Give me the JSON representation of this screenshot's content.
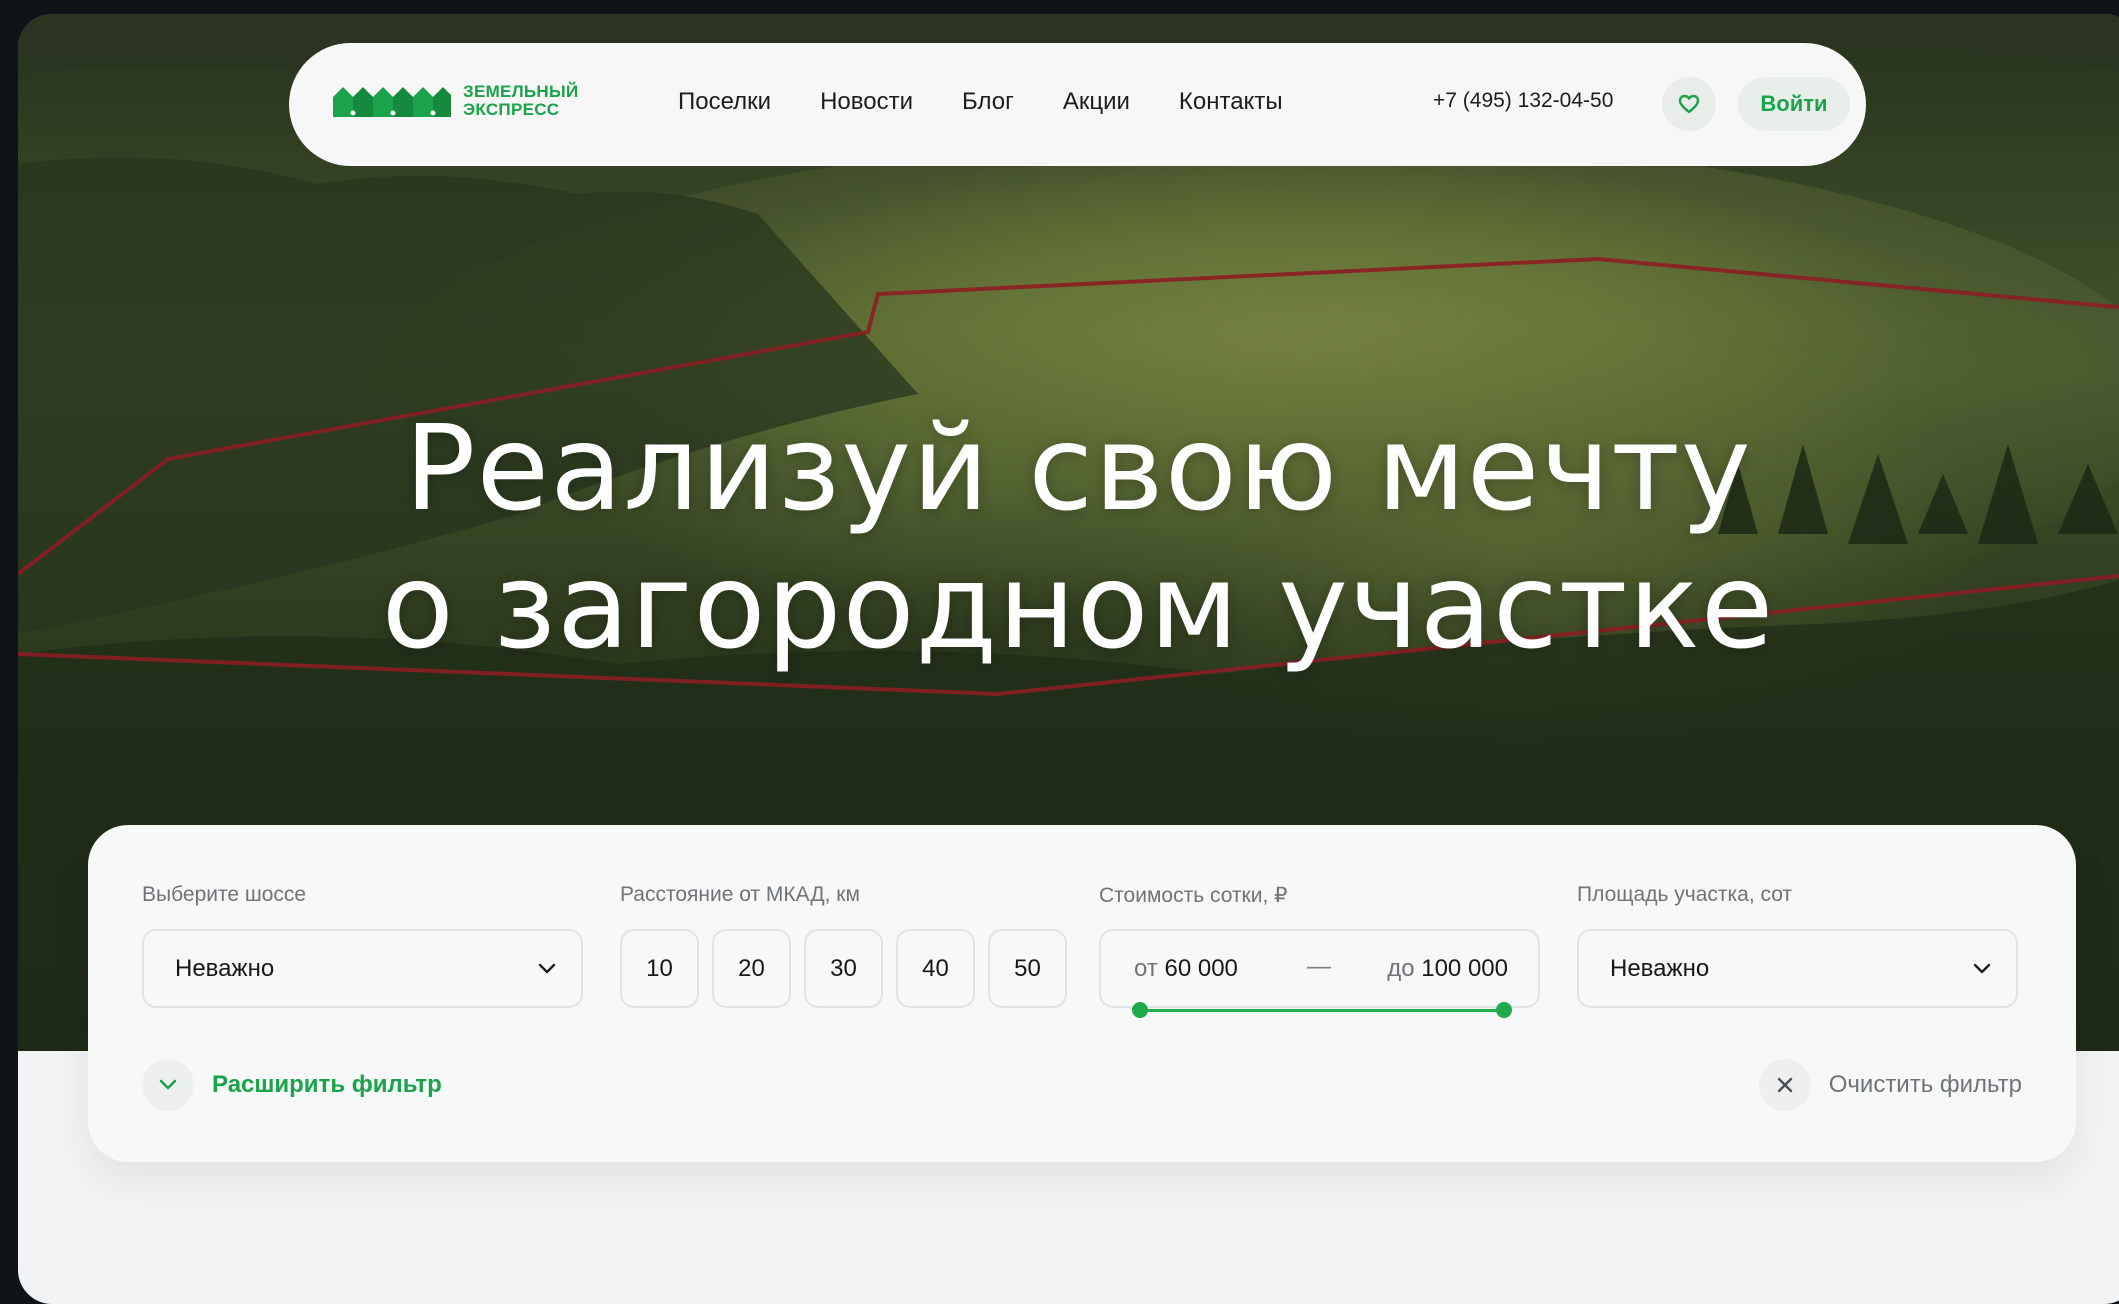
{
  "header": {
    "logo_line1": "ЗЕМЕЛЬНЫЙ",
    "logo_line2": "ЭКСПРЕСС",
    "nav": [
      "Поселки",
      "Новости",
      "Блог",
      "Акции",
      "Контакты"
    ],
    "phone": "+7 (495) 132-04-50",
    "favorites_icon": "heart-icon",
    "login_label": "Войти"
  },
  "hero": {
    "title_line1": "Реализуй свою мечту",
    "title_line2": "о загородном участке"
  },
  "filter": {
    "highway": {
      "label": "Выберите шоссе",
      "value": "Неважно"
    },
    "distance": {
      "label": "Расстояние от МКАД, км",
      "options": [
        "10",
        "20",
        "30",
        "40",
        "50"
      ]
    },
    "price": {
      "label": "Стоимость сотки, ₽",
      "from_prefix": "от",
      "from_value": "60 000",
      "separator": "—",
      "to_prefix": "до",
      "to_value": "100 000"
    },
    "area": {
      "label": "Площадь участка, сот",
      "value": "Неважно"
    },
    "expand_label": "Расширить фильтр",
    "clear_label": "Очистить фильтр"
  },
  "colors": {
    "accent": "#1aa34a",
    "boundary": "#8b1e24"
  }
}
